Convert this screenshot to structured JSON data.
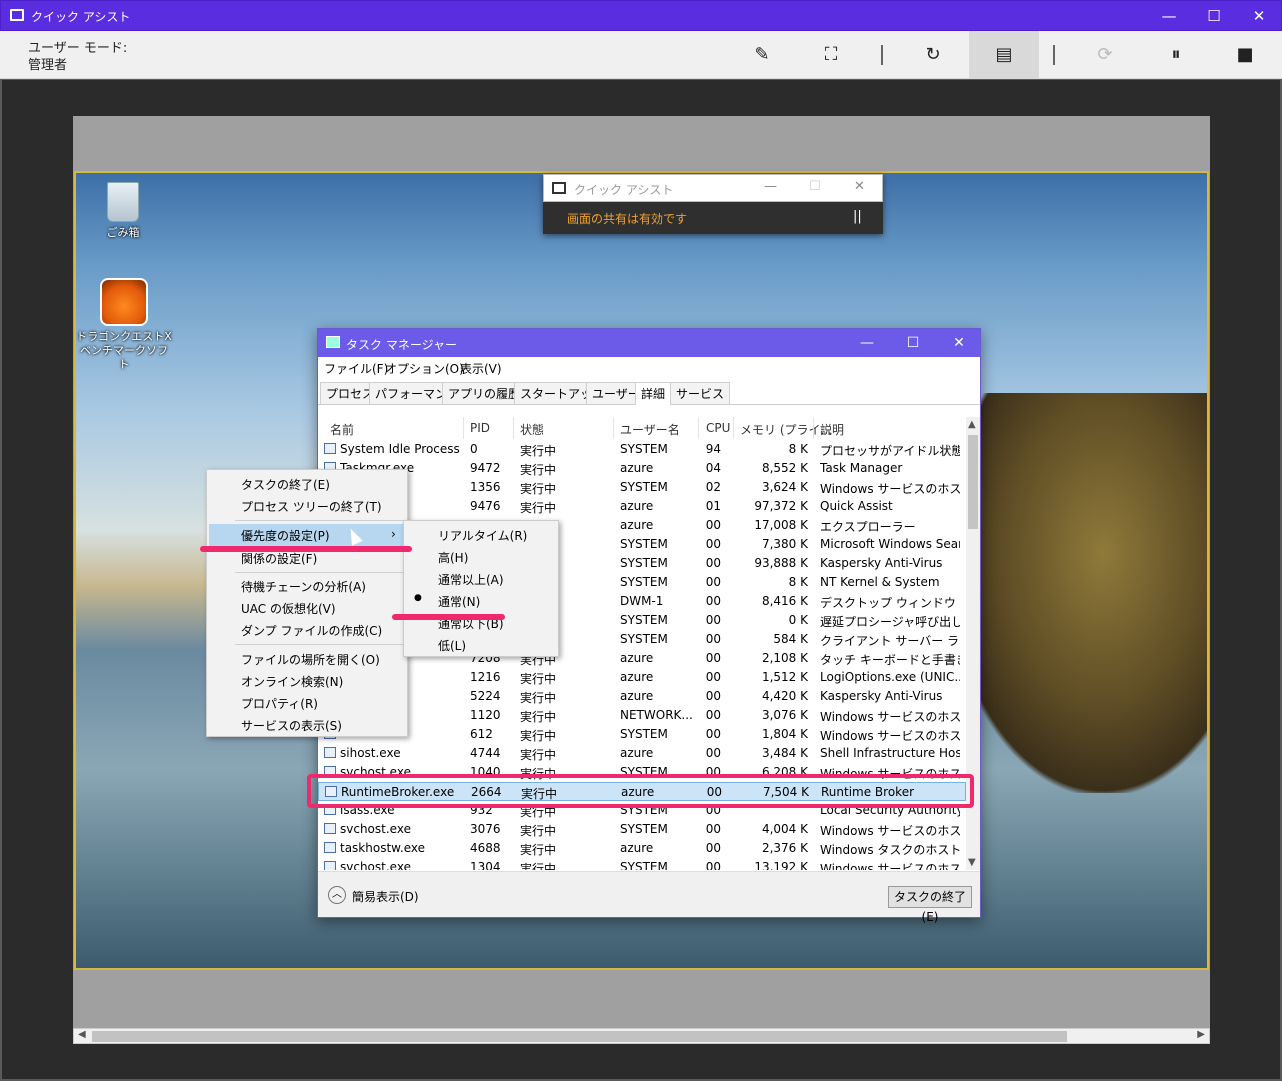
{
  "window": {
    "title": "クイック アシスト",
    "minimize": "—",
    "maximize": "☐",
    "close": "✕"
  },
  "toolbar": {
    "mode_label": "ユーザー モード:",
    "mode_value": "管理者"
  },
  "desktop": {
    "icons": [
      {
        "label": "ごみ箱"
      },
      {
        "label": "ドラゴンクエストX ベンチマークソフト"
      }
    ]
  },
  "mini_window": {
    "title": "クイック アシスト",
    "message": "画面の共有は有効です",
    "pause": "||"
  },
  "task_manager": {
    "title": "タスク マネージャー",
    "menu": [
      "ファイル(F)",
      "オプション(O)",
      "表示(V)"
    ],
    "tabs": [
      "プロセス",
      "パフォーマンス",
      "アプリの履歴",
      "スタートアップ",
      "ユーザー",
      "詳細",
      "サービス"
    ],
    "active_tab": "詳細",
    "columns": [
      "名前",
      "PID",
      "状態",
      "ユーザー名",
      "CPU",
      "メモリ (プライ...",
      "説明"
    ],
    "rows": [
      [
        "System Idle Process",
        "0",
        "実行中",
        "SYSTEM",
        "94",
        "8 K",
        "プロセッサがアイドル状態に..."
      ],
      [
        "Taskmgr.exe",
        "9472",
        "実行中",
        "azure",
        "04",
        "8,552 K",
        "Task Manager"
      ],
      [
        "",
        "1356",
        "実行中",
        "SYSTEM",
        "02",
        "3,624 K",
        "Windows サービスのホスト..."
      ],
      [
        "exe",
        "9476",
        "実行中",
        "azure",
        "01",
        "97,372 K",
        "Quick Assist"
      ],
      [
        "",
        "",
        "",
        "azure",
        "00",
        "17,008 K",
        "エクスプローラー"
      ],
      [
        "",
        "",
        "",
        "SYSTEM",
        "00",
        "7,380 K",
        "Microsoft Windows Sear..."
      ],
      [
        "",
        "",
        "",
        "SYSTEM",
        "00",
        "93,888 K",
        "Kaspersky Anti-Virus"
      ],
      [
        "",
        "",
        "",
        "SYSTEM",
        "00",
        "8 K",
        "NT Kernel & System"
      ],
      [
        "",
        "",
        "",
        "DWM-1",
        "00",
        "8,416 K",
        "デスクトップ ウィンドウ マネー..."
      ],
      [
        "",
        "",
        "",
        "SYSTEM",
        "00",
        "0 K",
        "遅延プロシージャ呼び出し..."
      ],
      [
        "",
        "",
        "",
        "SYSTEM",
        "00",
        "584 K",
        "クライアント サーバー ランタ..."
      ],
      [
        "",
        "7208",
        "実行中",
        "azure",
        "00",
        "2,108 K",
        "タッチ キーボードと手書きパ..."
      ],
      [
        "exe",
        "1216",
        "実行中",
        "azure",
        "00",
        "1,512 K",
        "LogiOptions.exe (UNIC..."
      ],
      [
        "",
        "5224",
        "実行中",
        "azure",
        "00",
        "4,420 K",
        "Kaspersky Anti-Virus"
      ],
      [
        "",
        "1120",
        "実行中",
        "NETWORK...",
        "00",
        "3,076 K",
        "Windows サービスのホスト..."
      ],
      [
        "",
        "612",
        "実行中",
        "SYSTEM",
        "00",
        "1,804 K",
        "Windows サービスのホスト..."
      ],
      [
        "sihost.exe",
        "4744",
        "実行中",
        "azure",
        "00",
        "3,484 K",
        "Shell Infrastructure Host"
      ],
      [
        "svchost.exe",
        "1040",
        "実行中",
        "SYSTEM",
        "00",
        "6,208 K",
        "Windows サービスのホスト..."
      ],
      [
        "RuntimeBroker.exe",
        "2664",
        "実行中",
        "azure",
        "00",
        "7,504 K",
        "Runtime Broker"
      ],
      [
        "lsass.exe",
        "932",
        "実行中",
        "SYSTEM",
        "00",
        "",
        "Local Security Authority..."
      ],
      [
        "svchost.exe",
        "3076",
        "実行中",
        "SYSTEM",
        "00",
        "4,004 K",
        "Windows サービスのホスト..."
      ],
      [
        "taskhostw.exe",
        "4688",
        "実行中",
        "azure",
        "00",
        "2,376 K",
        "Windows タスクのホスト プ..."
      ],
      [
        "svchost.exe",
        "1304",
        "実行中",
        "SYSTEM",
        "00",
        "13,192 K",
        "Windows サービスのホスト..."
      ]
    ],
    "selected_row": "RuntimeBroker.exe",
    "footer": {
      "fewer_details": "簡易表示(D)",
      "end_task": "タスクの終了(E)"
    }
  },
  "context_menu": {
    "items": [
      "タスクの終了(E)",
      "プロセス ツリーの終了(T)",
      "優先度の設定(P)",
      "関係の設定(F)",
      "待機チェーンの分析(A)",
      "UAC の仮想化(V)",
      "ダンプ ファイルの作成(C)",
      "ファイルの場所を開く(O)",
      "オンライン検索(N)",
      "プロパティ(R)",
      "サービスの表示(S)"
    ],
    "submenu_arrow": "›"
  },
  "priority_submenu": {
    "items": [
      "リアルタイム(R)",
      "高(H)",
      "通常以上(A)",
      "通常(N)",
      "通常以下(B)",
      "低(L)"
    ],
    "checked": "通常(N)",
    "bullet": "●"
  },
  "colors": {
    "titlebar": "#5b2de0",
    "taskmgr_title": "#6b5be8",
    "highlight": "#f0286e",
    "selection": "#cce4f7"
  }
}
